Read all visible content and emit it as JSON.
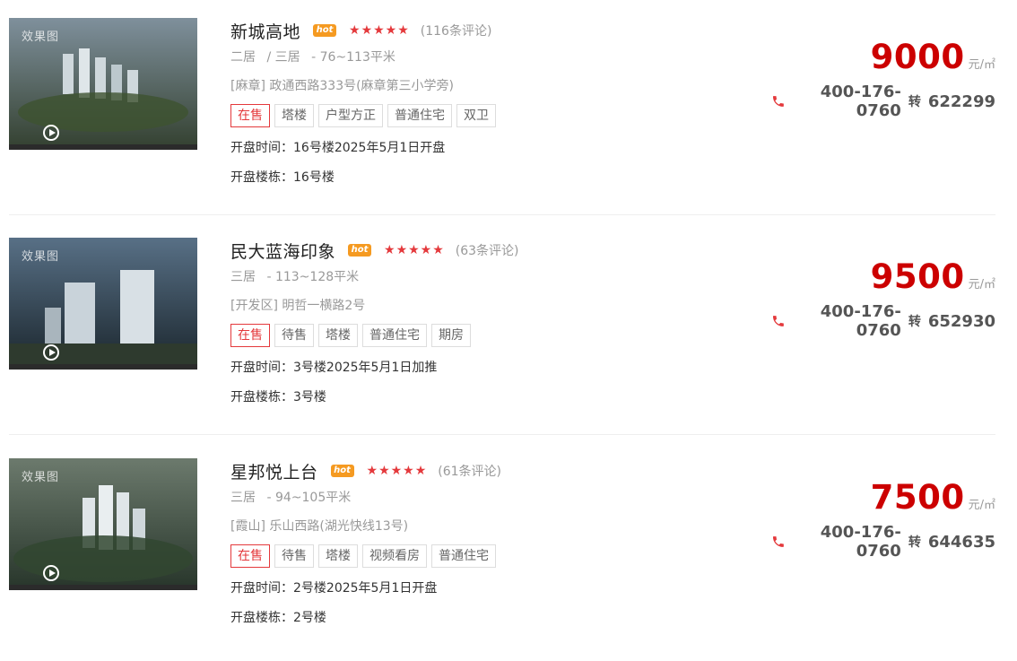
{
  "listings": [
    {
      "thumb_label": "效果图",
      "name": "新城高地",
      "hot_label": "hot",
      "stars": "★★★★★",
      "reviews": "(116条评论)",
      "rooms": [
        "二居",
        "/ 三居",
        "- 76~113平米"
      ],
      "address": "[麻章] 政通西路333号(麻章第三小学旁)",
      "tags": [
        "在售",
        "塔楼",
        "户型方正",
        "普通住宅",
        "双卫"
      ],
      "open_time": "开盘时间：16号楼2025年5月1日开盘",
      "open_building": "开盘楼栋：16号楼",
      "price": "9000",
      "price_unit": "元/㎡",
      "phone": "400-176-0760",
      "ext_label": "转",
      "ext": "622299",
      "thumb_colors": [
        "#6b7d8a",
        "#3d4a3a"
      ]
    },
    {
      "thumb_label": "效果图",
      "name": "民大蓝海印象",
      "hot_label": "hot",
      "stars": "★★★★★",
      "reviews": "(63条评论)",
      "rooms": [
        "三居",
        "- 113~128平米"
      ],
      "address": "[开发区] 明哲一横路2号",
      "tags": [
        "在售",
        "待售",
        "塔楼",
        "普通住宅",
        "期房"
      ],
      "open_time": "开盘时间：3号楼2025年5月1日加推",
      "open_building": "开盘楼栋：3号楼",
      "price": "9500",
      "price_unit": "元/㎡",
      "phone": "400-176-0760",
      "ext_label": "转",
      "ext": "652930",
      "thumb_colors": [
        "#4b6275",
        "#1d2a33"
      ]
    },
    {
      "thumb_label": "效果图",
      "name": "星邦悦上台",
      "hot_label": "hot",
      "stars": "★★★★★",
      "reviews": "(61条评论)",
      "rooms": [
        "三居",
        "- 94~105平米"
      ],
      "address": "[霞山] 乐山西路(湖光快线13号)",
      "tags": [
        "在售",
        "待售",
        "塔楼",
        "视频看房",
        "普通住宅"
      ],
      "open_time": "开盘时间：2号楼2025年5月1日开盘",
      "open_building": "开盘楼栋：2号楼",
      "price": "7500",
      "price_unit": "元/㎡",
      "phone": "400-176-0760",
      "ext_label": "转",
      "ext": "644635",
      "thumb_colors": [
        "#5d6a5d",
        "#2c3a2e"
      ]
    }
  ]
}
